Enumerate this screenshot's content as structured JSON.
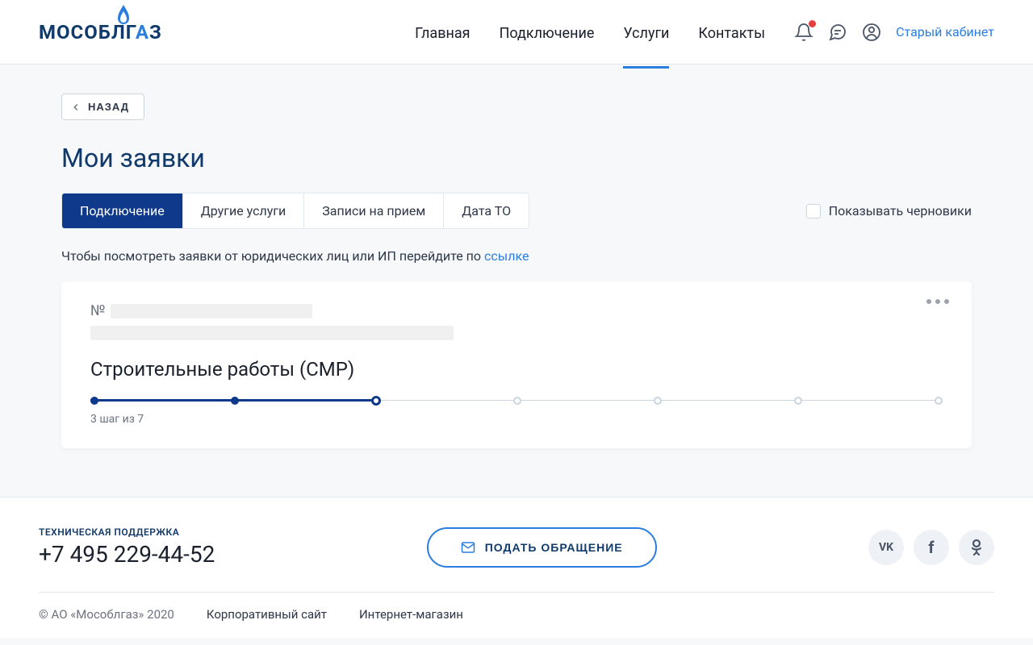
{
  "header": {
    "logo_text_pre": "МОСОБЛГ",
    "logo_text_a": "А",
    "logo_text_post": "З",
    "nav": [
      "Главная",
      "Подключение",
      "Услуги",
      "Контакты"
    ],
    "active_nav_index": 2,
    "old_cabinet": "Старый кабинет"
  },
  "back_label": "НАЗАД",
  "page_title": "Мои заявки",
  "tabs": [
    "Подключение",
    "Другие услуги",
    "Записи на прием",
    "Дата ТО"
  ],
  "active_tab_index": 0,
  "drafts_label": "Показывать черновики",
  "info_text_pre": "Чтобы посмотреть заявки от юридических лиц или ИП перейдите по ",
  "info_text_link": "ссылке",
  "card": {
    "num_prefix": "№",
    "title": "Строительные работы (СМР)",
    "total_steps": 7,
    "current_step": 3,
    "step_text": "3 шаг из 7"
  },
  "footer": {
    "support_label": "ТЕХНИЧЕСКАЯ ПОДДЕРЖКА",
    "phone": "+7 495 229-44-52",
    "submit_label": "ПОДАТЬ ОБРАЩЕНИЕ",
    "copyright": "© АО «Мособлгаз» 2020",
    "links": [
      "Корпоративный сайт",
      "Интернет-магазин"
    ]
  }
}
